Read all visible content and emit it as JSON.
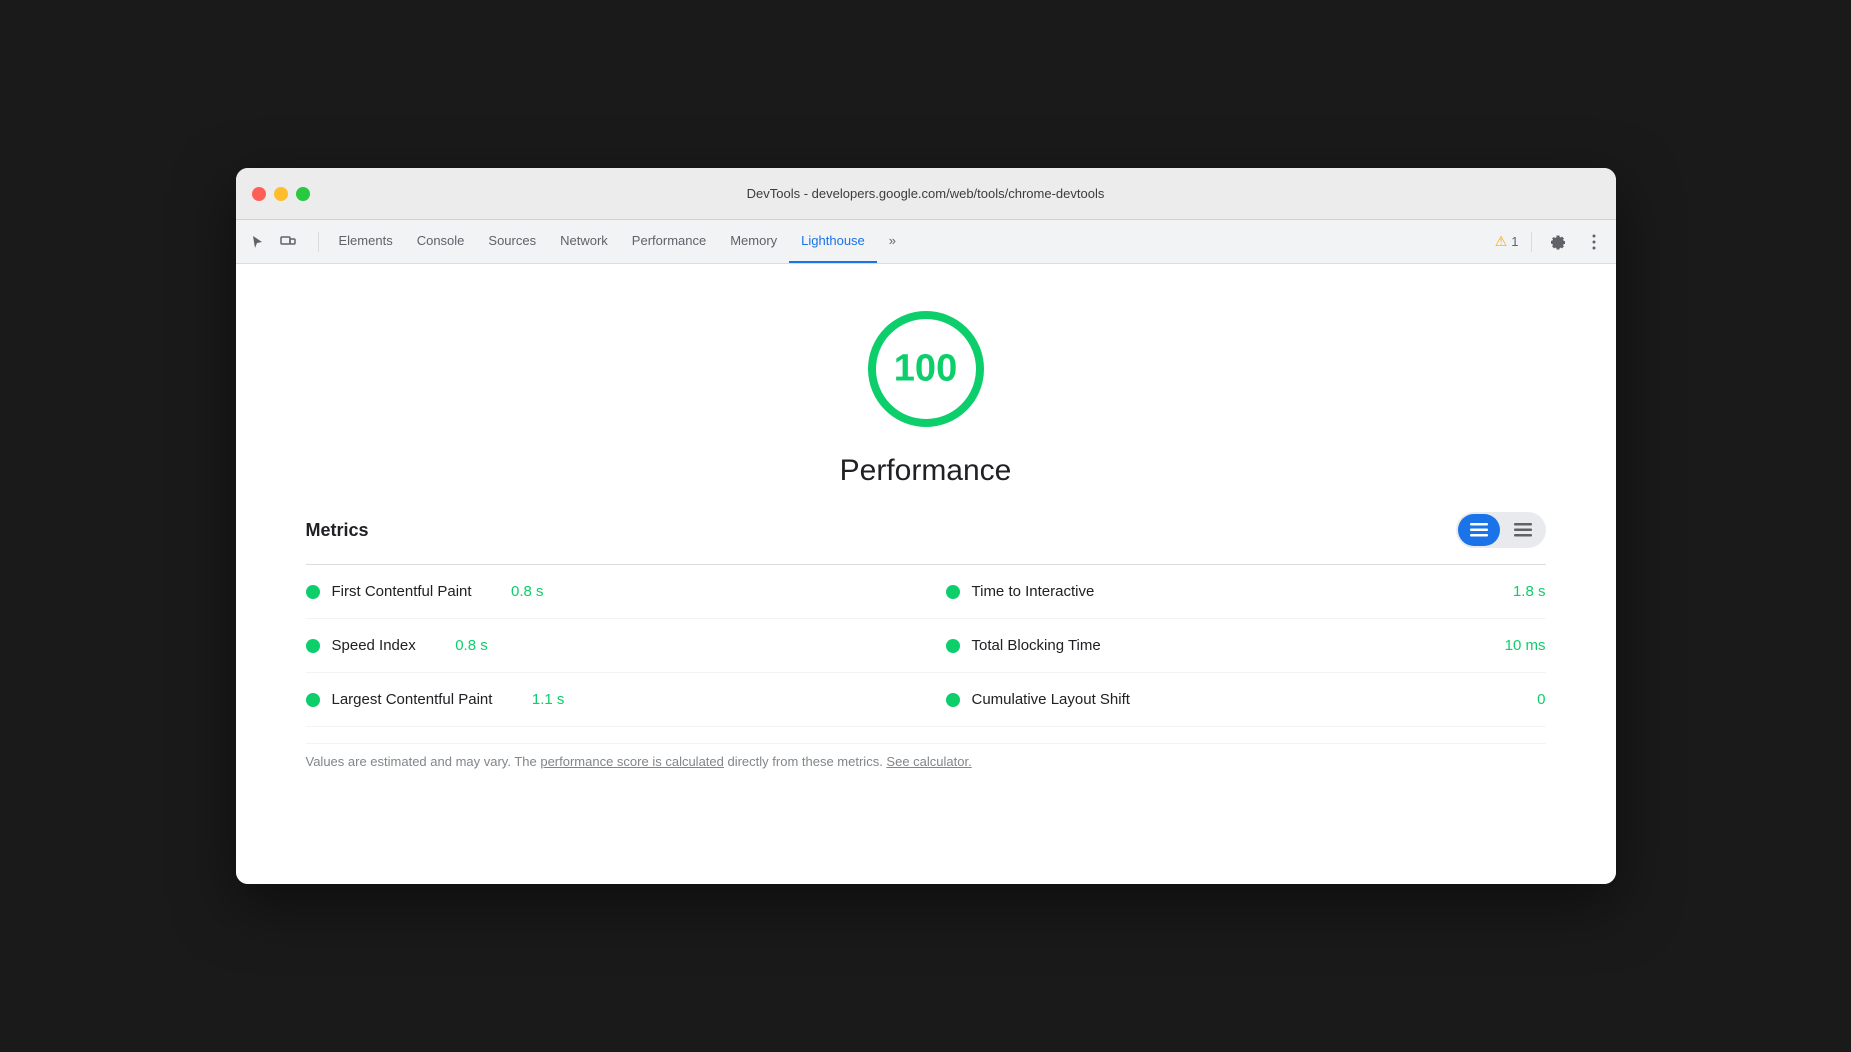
{
  "window": {
    "title": "DevTools - developers.google.com/web/tools/chrome-devtools"
  },
  "toolbar": {
    "tabs": [
      {
        "id": "elements",
        "label": "Elements",
        "active": false
      },
      {
        "id": "console",
        "label": "Console",
        "active": false
      },
      {
        "id": "sources",
        "label": "Sources",
        "active": false
      },
      {
        "id": "network",
        "label": "Network",
        "active": false
      },
      {
        "id": "performance",
        "label": "Performance",
        "active": false
      },
      {
        "id": "memory",
        "label": "Memory",
        "active": false
      },
      {
        "id": "lighthouse",
        "label": "Lighthouse",
        "active": true
      }
    ],
    "more_tabs": "»",
    "warning_count": "1",
    "settings_label": "Settings",
    "more_options_label": "More options"
  },
  "lighthouse": {
    "score": "100",
    "score_label": "Performance",
    "metrics_title": "Metrics",
    "metrics": [
      {
        "name": "First Contentful Paint",
        "value": "0.8 s",
        "right_name": "Time to Interactive",
        "right_value": "1.8 s"
      },
      {
        "name": "Speed Index",
        "value": "0.8 s",
        "right_name": "Total Blocking Time",
        "right_value": "10 ms"
      },
      {
        "name": "Largest Contentful Paint",
        "value": "1.1 s",
        "right_name": "Cumulative Layout Shift",
        "right_value": "0"
      }
    ],
    "footer_text": "Values are estimated and may vary. The ",
    "footer_link1": "performance score is calculated",
    "footer_mid": " directly from these metrics. ",
    "footer_link2": "See calculator.",
    "colors": {
      "score": "#0cce6b",
      "good": "#0cce6b"
    }
  }
}
